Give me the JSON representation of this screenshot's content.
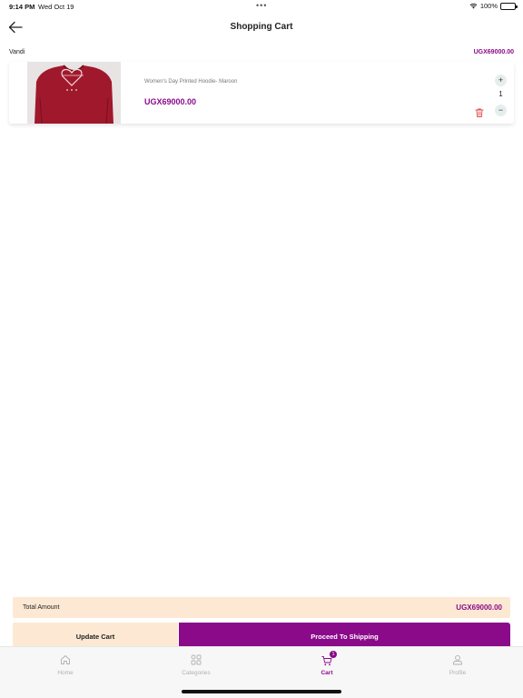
{
  "status_bar": {
    "time": "9:14 PM",
    "date": "Wed Oct 19",
    "battery": "100%"
  },
  "header": {
    "title": "Shopping Cart",
    "back_icon": "arrow-left-icon"
  },
  "vendor": {
    "name": "Vandi",
    "subtotal": "UGX69000.00"
  },
  "cart_items": [
    {
      "name": "Women's Day Printed Hoodie- Maroon",
      "price": "UGX69000.00",
      "quantity": "1",
      "plus_symbol": "+",
      "minus_symbol": "−",
      "image_color": "#a0182c"
    }
  ],
  "summary": {
    "total_label": "Total Amount",
    "total_amount": "UGX69000.00"
  },
  "actions": {
    "update_cart": "Update Cart",
    "proceed": "Proceed To Shipping"
  },
  "tabs": [
    {
      "label": "Home",
      "icon": "home-icon",
      "active": false
    },
    {
      "label": "Categories",
      "icon": "grid-icon",
      "active": false
    },
    {
      "label": "Cart",
      "icon": "cart-icon",
      "active": true,
      "badge": "1"
    },
    {
      "label": "Profile",
      "icon": "person-icon",
      "active": false
    }
  ],
  "colors": {
    "brand": "#8a0a8a",
    "accent_light": "#fde9d3",
    "delete": "#e05050"
  }
}
